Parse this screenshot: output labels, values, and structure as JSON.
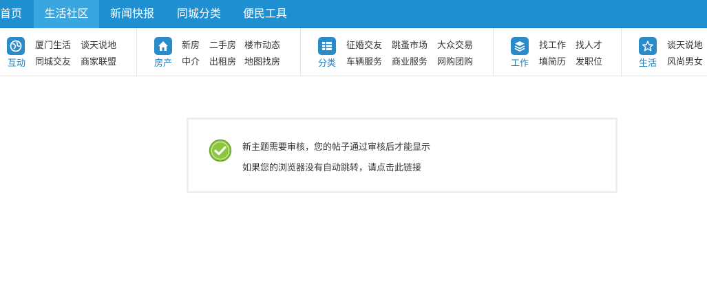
{
  "topnav": {
    "items": [
      {
        "label": "首页",
        "active": false
      },
      {
        "label": "生活社区",
        "active": true
      },
      {
        "label": "新闻快报",
        "active": false
      },
      {
        "label": "同城分类",
        "active": false
      },
      {
        "label": "便民工具",
        "active": false
      }
    ]
  },
  "subnav": {
    "groups": [
      {
        "caption": "互动",
        "icon": "globe-icon",
        "links": [
          [
            "厦门生活",
            "谈天说地"
          ],
          [
            "同城交友",
            "商家联盟"
          ]
        ]
      },
      {
        "caption": "房产",
        "icon": "house-icon",
        "links": [
          [
            "新房",
            "二手房",
            "楼市动态"
          ],
          [
            "中介",
            "出租房",
            "地图找房"
          ]
        ]
      },
      {
        "caption": "分类",
        "icon": "list-icon",
        "links": [
          [
            "征婚交友",
            "跳蚤市场",
            "大众交易"
          ],
          [
            "车辆服务",
            "商业服务",
            "网购团购"
          ]
        ]
      },
      {
        "caption": "工作",
        "icon": "layers-icon",
        "links": [
          [
            "找工作",
            "找人才"
          ],
          [
            "填简历",
            "发职位"
          ]
        ]
      },
      {
        "caption": "生活",
        "icon": "star-icon",
        "links": [
          [
            "谈天说地"
          ],
          [
            "风尚男女"
          ]
        ]
      }
    ]
  },
  "message": {
    "icon": "check-circle-icon",
    "line1": "新主题需要审核，您的帖子通过审核后才能显示",
    "line2": "如果您的浏览器没有自动跳转，请点击此链接"
  },
  "colors": {
    "nav_bg": "#1e8fd0",
    "nav_active": "#3aa6df",
    "icon_bg": "#2a8bc9",
    "caption": "#1e7fc0",
    "check": "#8cc63e"
  }
}
